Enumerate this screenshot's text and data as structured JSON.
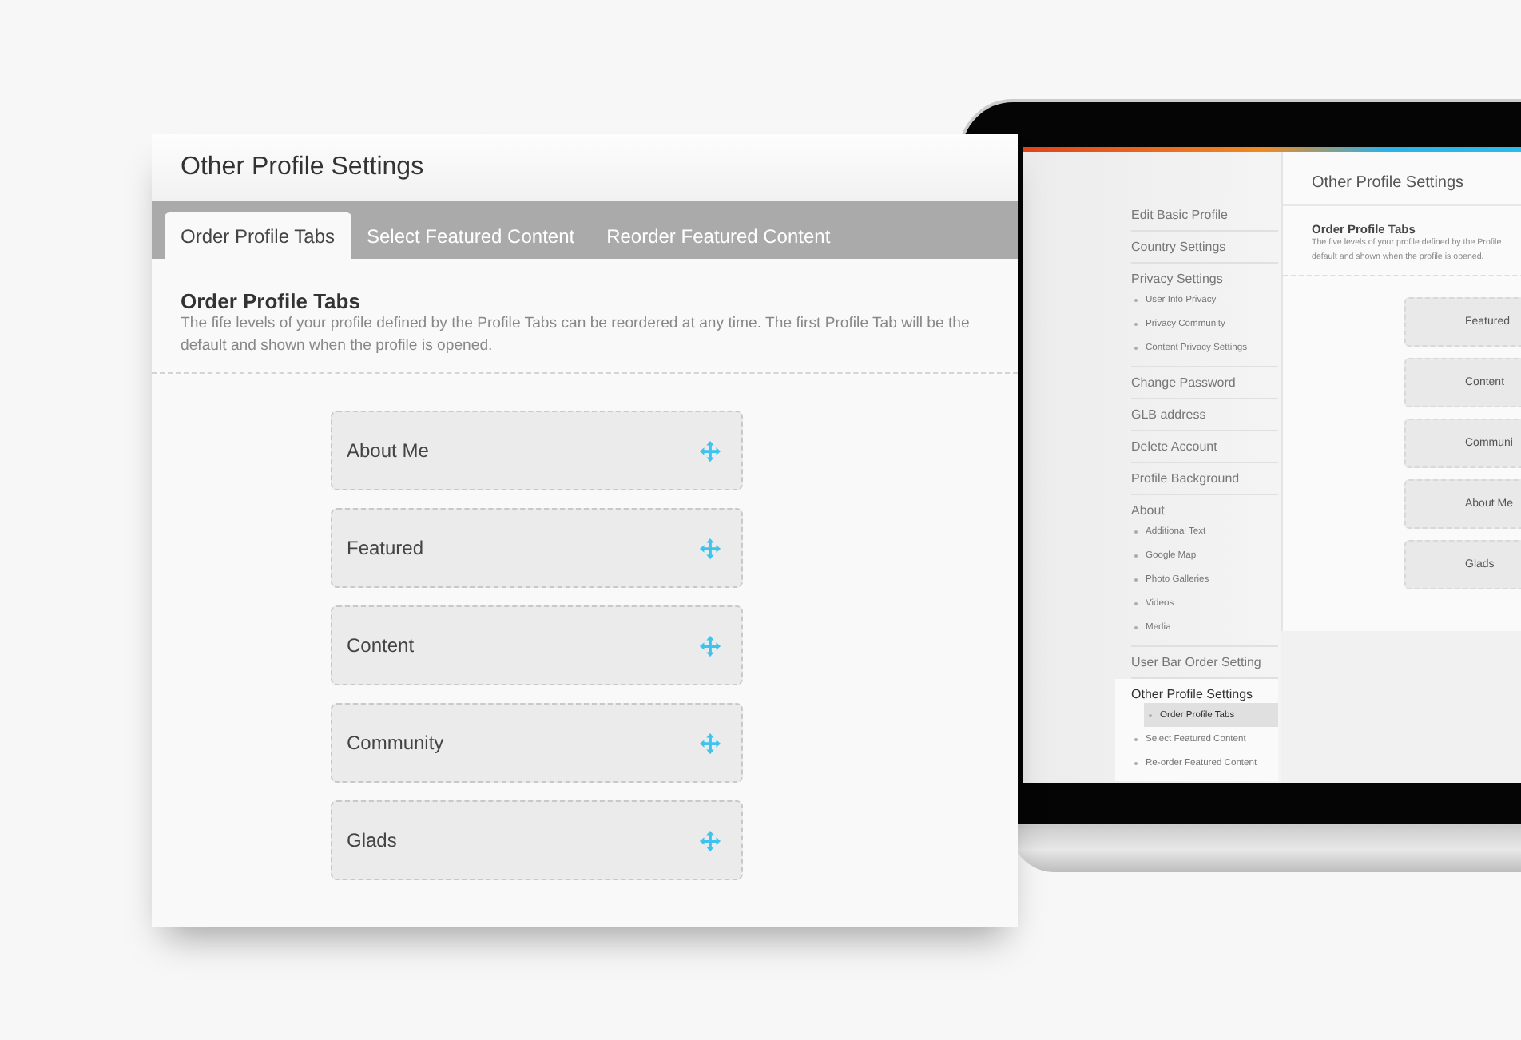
{
  "card": {
    "title": "Other Profile Settings",
    "tabs": [
      {
        "label": "Order Profile Tabs",
        "selected": true
      },
      {
        "label": "Select Featured Content",
        "selected": false
      },
      {
        "label": "Reorder Featured Content",
        "selected": false
      }
    ],
    "section": {
      "heading": "Order Profile Tabs",
      "description": "The fife levels of your profile defined by the Profile Tabs can be reordered at any time. The first Profile Tab will be the default and shown when the profile is opened."
    },
    "items": [
      {
        "label": "About Me"
      },
      {
        "label": "Featured"
      },
      {
        "label": "Content"
      },
      {
        "label": "Community"
      },
      {
        "label": "Glads"
      }
    ]
  },
  "laptop": {
    "sidebar": [
      {
        "label": "Edit Basic Profile",
        "selected": false
      },
      {
        "label": "Country Settings",
        "selected": false
      },
      {
        "label": "Privacy Settings",
        "selected": false,
        "children": [
          {
            "label": "User Info Privacy",
            "selected": false
          },
          {
            "label": "Privacy Community",
            "selected": false
          },
          {
            "label": "Content Privacy Settings",
            "selected": false
          }
        ]
      },
      {
        "label": "Change Password",
        "selected": false
      },
      {
        "label": "GLB address",
        "selected": false
      },
      {
        "label": "Delete Account",
        "selected": false
      },
      {
        "label": "Profile Background",
        "selected": false
      },
      {
        "label": "About",
        "selected": false,
        "children": [
          {
            "label": "Additional Text",
            "selected": false
          },
          {
            "label": "Google Map",
            "selected": false
          },
          {
            "label": "Photo Galleries",
            "selected": false
          },
          {
            "label": "Videos",
            "selected": false
          },
          {
            "label": "Media",
            "selected": false
          }
        ]
      },
      {
        "label": "User Bar Order Setting",
        "selected": false
      },
      {
        "label": "Other Profile Settings",
        "selected": true,
        "children": [
          {
            "label": "Order Profile Tabs",
            "selected": true
          },
          {
            "label": "Select Featured Content",
            "selected": false
          },
          {
            "label": "Re-order Featured Content",
            "selected": false
          }
        ]
      }
    ],
    "panel": {
      "title": "Other Profile Settings",
      "heading": "Order Profile Tabs",
      "description_lines": [
        "The five levels of your profile defined by the Profile",
        "default and shown when the profile is opened."
      ],
      "items": [
        {
          "label": "Featured"
        },
        {
          "label": "Content"
        },
        {
          "label": "Communi"
        },
        {
          "label": "About Me"
        },
        {
          "label": "Glads"
        }
      ]
    }
  }
}
